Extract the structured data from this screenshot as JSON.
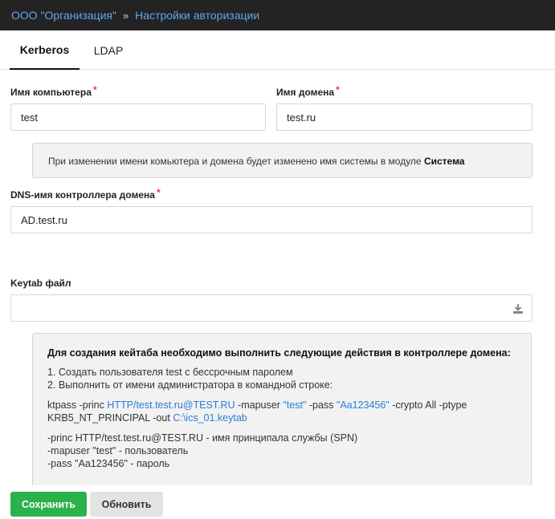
{
  "breadcrumb": {
    "org": "ООО \"Организация\"",
    "separator": "»",
    "page": "Настройки авторизации"
  },
  "tabs": [
    {
      "label": "Kerberos",
      "active": true
    },
    {
      "label": "LDAP",
      "active": false
    }
  ],
  "form": {
    "computer_name": {
      "label": "Имя компьютера",
      "required_mark": "*",
      "value": "test"
    },
    "domain_name": {
      "label": "Имя домена",
      "required_mark": "*",
      "value": "test.ru"
    },
    "info": {
      "text": "При изменении имени комьютера и домена будет изменено имя системы в модуле ",
      "bold": "Система"
    },
    "dns_name": {
      "label": "DNS-имя контроллера домена",
      "required_mark": "*",
      "value": "AD.test.ru"
    },
    "keytab": {
      "label": "Keytab файл",
      "value": "",
      "icon": "download-icon"
    }
  },
  "instructions": {
    "header": "Для создания кейтаба необходимо выполнить следующие действия в контроллере домена:",
    "step1": "1. Создать пользователя test с бессрочным паролем",
    "step2": "2. Выполнить от имени администратора в командной строке:",
    "cmd": {
      "p1": "ktpass -princ ",
      "princ": "HTTP/test.test.ru@TEST.RU",
      "p2": " -mapuser ",
      "user": "\"test\"",
      "p3": " -pass ",
      "pass": "\"Aa123456\"",
      "p4": " -crypto All -ptype KRB5_NT_PRINCIPAL -out ",
      "out": "C:\\ics_01.keytab"
    },
    "notes": [
      "-princ HTTP/test.test.ru@TEST.RU - имя принципала службы (SPN)",
      "-mapuser \"test\" - пользователь",
      "-pass \"Aa123456\" - пароль"
    ]
  },
  "buttons": {
    "save": "Сохранить",
    "refresh": "Обновить"
  },
  "colors": {
    "topbar_bg": "#232323",
    "link": "#5fa8f0",
    "accent_link": "#2a7cd4",
    "required": "#e33333",
    "save_bg": "#2bb24c"
  }
}
